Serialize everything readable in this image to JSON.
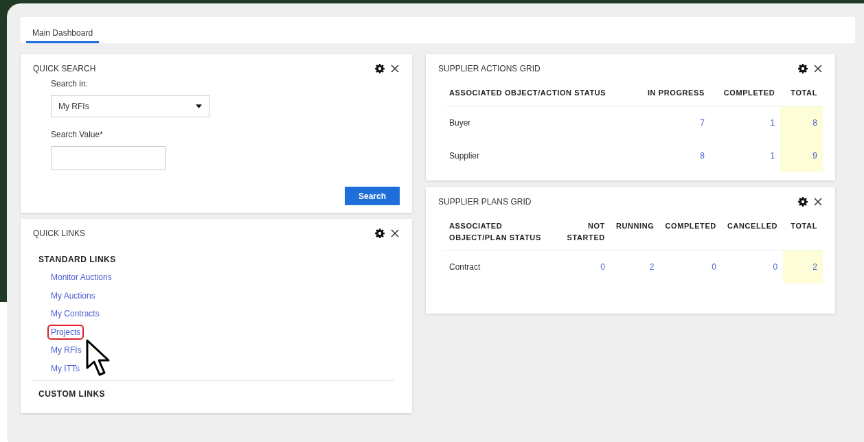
{
  "tabs": [
    {
      "label": "Main Dashboard",
      "selected": true
    }
  ],
  "quick_search": {
    "title": "QUICK SEARCH",
    "search_in_label": "Search in:",
    "search_in_value": "My RFIs",
    "search_value_label": "Search Value*",
    "button": "Search"
  },
  "quick_links": {
    "title": "QUICK LINKS",
    "sections": [
      {
        "title": "STANDARD LINKS",
        "links": [
          {
            "label": "Monitor Auctions",
            "highlighted": false
          },
          {
            "label": "My Auctions",
            "highlighted": false
          },
          {
            "label": "My Contracts",
            "highlighted": false
          },
          {
            "label": "Projects",
            "highlighted": true
          },
          {
            "label": "My RFIs",
            "highlighted": false
          },
          {
            "label": "My ITTs",
            "highlighted": false
          }
        ]
      },
      {
        "title": "CUSTOM LINKS"
      }
    ]
  },
  "grids": [
    {
      "title": "SUPPLIER ACTIONS GRID",
      "columns": [
        {
          "label": "ASSOCIATED OBJECT/ACTION STATUS",
          "highlighted": false
        },
        {
          "label": "IN PROGRESS",
          "highlighted": false
        },
        {
          "label": "COMPLETED",
          "highlighted": false
        },
        {
          "label": "TOTAL",
          "highlighted": true
        }
      ],
      "rows": [
        [
          "Buyer",
          "7",
          "1",
          "8"
        ],
        [
          "Supplier",
          "8",
          "1",
          "9"
        ]
      ]
    },
    {
      "title": "SUPPLIER PLANS GRID",
      "columns": [
        {
          "label": "ASSOCIATED OBJECT/PLAN STATUS",
          "highlighted": false
        },
        {
          "label": "NOT STARTED",
          "highlighted": false
        },
        {
          "label": "RUNNING",
          "highlighted": false
        },
        {
          "label": "COMPLETED",
          "highlighted": false
        },
        {
          "label": "CANCELLED",
          "highlighted": false
        },
        {
          "label": "TOTAL",
          "highlighted": true
        }
      ],
      "rows": [
        [
          "Contract",
          "0",
          "2",
          "0",
          "0",
          "2"
        ]
      ]
    }
  ]
}
